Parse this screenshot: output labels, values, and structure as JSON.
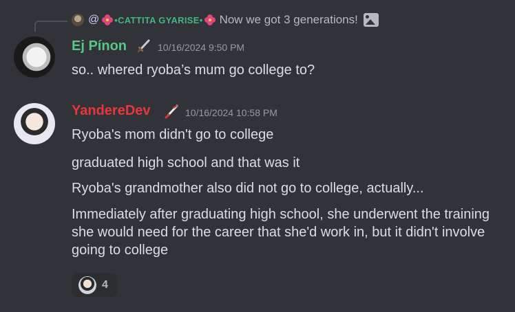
{
  "reply_preview": {
    "mention_prefix": "@",
    "username": "•CATTITA GYARISE•",
    "text": "Now we got 3 generations!",
    "attachment_icon": "image-icon"
  },
  "messages": [
    {
      "username": "Ej Pínon",
      "role_icon": "dagger-icon",
      "timestamp": "10/16/2024 9:50 PM",
      "lines": [
        "so.. whered ryoba’s mum go college to?"
      ]
    },
    {
      "username": "YandereDev",
      "role_icon": "knife-icon",
      "timestamp": "10/16/2024 10:58 PM",
      "lines": [
        "Ryoba's mom didn't go to college",
        "graduated high school and that was it",
        "Ryoba's grandmother also did not go to college, actually...",
        "Immediately after graduating high school, she underwent the training she would need for the career that she'd work in, but it didn't involve going to college"
      ],
      "reaction": {
        "emoji": "anime-girl-emoji",
        "count": "4"
      }
    }
  ],
  "colors": {
    "background": "#313338",
    "username_ej": "#57c785",
    "username_yd": "#e8363b",
    "reply_name": "#43b581",
    "timestamp": "#949ba4"
  }
}
